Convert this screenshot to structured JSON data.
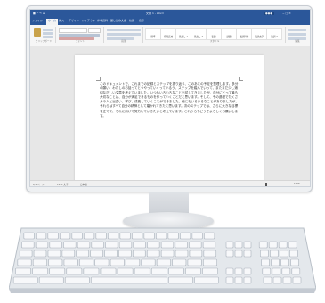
{
  "window": {
    "quick_access": "■ ↶ ↷ ≡",
    "title": "文書 1 - Word",
    "user": "●●●",
    "controls": "−  □  ✕"
  },
  "tabs": [
    "ファイル",
    "ホーム",
    "挿入",
    "デザイン",
    "レイアウト",
    "参考資料",
    "差し込み文書",
    "校閲",
    "表示"
  ],
  "ribbon": {
    "groups": [
      "クリップボード",
      "フォント",
      "段落",
      "スタイル",
      "編集"
    ],
    "styles": [
      "標準",
      "行間詰め",
      "見出し 1",
      "見出し 2",
      "表題",
      "副題",
      "強調斜体",
      "強調太字",
      "強調 2"
    ]
  },
  "document": {
    "body": "このドキュメントで、これまでの記録とステップを振り返り、このあとの予定を整理します。多分の願い、わたしのお話ってとうやっていくっているう、ステップを踏んでいって、またまだ少し適切な正しい文章を考えていました。いつもいろいろなことを試してきましたが、自分にとって最も大切なことは、自分が満足できるものを作っていくことだと思います。そして、その過程でたくさんの人と出会い、学び、成長していくことができました。他にもいろいろなことがありましたが、それらはすべて自分の精神として磨かれてきたと思います。次のステップでは、さらに大きな目標を立てて、それに向けて努力していきたいと考えています。これからもどうぞよろしくお願いします。"
  },
  "statusbar": {
    "page": "1/1 ページ",
    "words": "1111 文字",
    "lang": "日本語",
    "zoom": "100%"
  },
  "colors": {
    "titlebar": "#2b579a",
    "monitor": "#eef0f2",
    "keyboard": "#dde2e8"
  },
  "keyboard": {
    "rows": [
      {
        "keys": 16
      },
      {
        "keys": 14
      },
      {
        "keys": 14
      },
      {
        "keys": 13
      },
      {
        "keys": 12
      },
      {
        "keys": 8
      }
    ]
  }
}
